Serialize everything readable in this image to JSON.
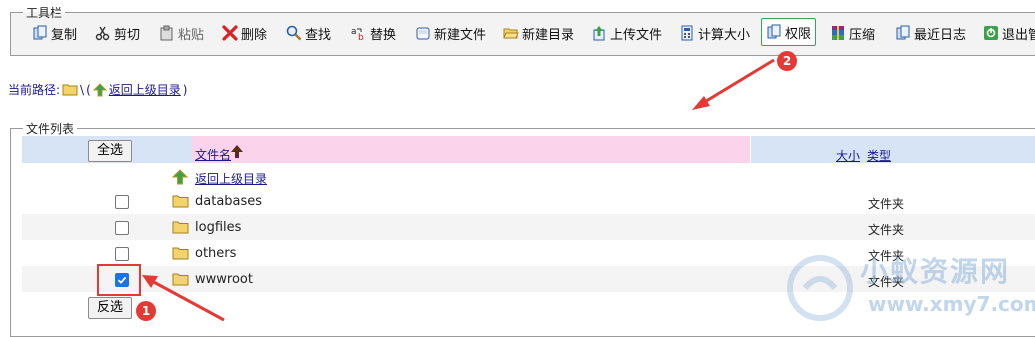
{
  "toolbar": {
    "legend": "工具栏",
    "buttons": [
      {
        "label": "复制"
      },
      {
        "label": "剪切"
      },
      {
        "label": "粘贴"
      },
      {
        "label": "删除"
      },
      {
        "label": "查找"
      },
      {
        "label": "替换"
      },
      {
        "label": "新建文件"
      },
      {
        "label": "新建目录"
      },
      {
        "label": "上传文件"
      },
      {
        "label": "计算大小"
      },
      {
        "label": "权限"
      },
      {
        "label": "压缩"
      },
      {
        "label": "最近日志"
      },
      {
        "label": "退出管"
      }
    ]
  },
  "path": {
    "label": "当前路径:",
    "value": "\\",
    "open_paren": "(",
    "up_link": "返回上级目录",
    "close_paren": ")"
  },
  "file_list": {
    "legend": "文件列表",
    "select_all": "全选",
    "invert_select": "反选",
    "columns": {
      "name": "文件名",
      "size": "大小",
      "type": "类型"
    },
    "up_link": "返回上级目录",
    "rows": [
      {
        "name": "databases",
        "type": "文件夹",
        "checked": false
      },
      {
        "name": "logfiles",
        "type": "文件夹",
        "checked": false
      },
      {
        "name": "others",
        "type": "文件夹",
        "checked": false
      },
      {
        "name": "wwwroot",
        "type": "文件夹",
        "checked": true
      }
    ]
  },
  "annotations": {
    "badge1": "1",
    "badge2": "2"
  },
  "watermark": {
    "text": "小蚁资源网",
    "url": "www.xmy7.com"
  },
  "colors": {
    "annotation_red": "#e53935",
    "header_blue": "#d6e4f6",
    "header_pink": "#fbd3ea",
    "active_border": "#3aa35a"
  }
}
